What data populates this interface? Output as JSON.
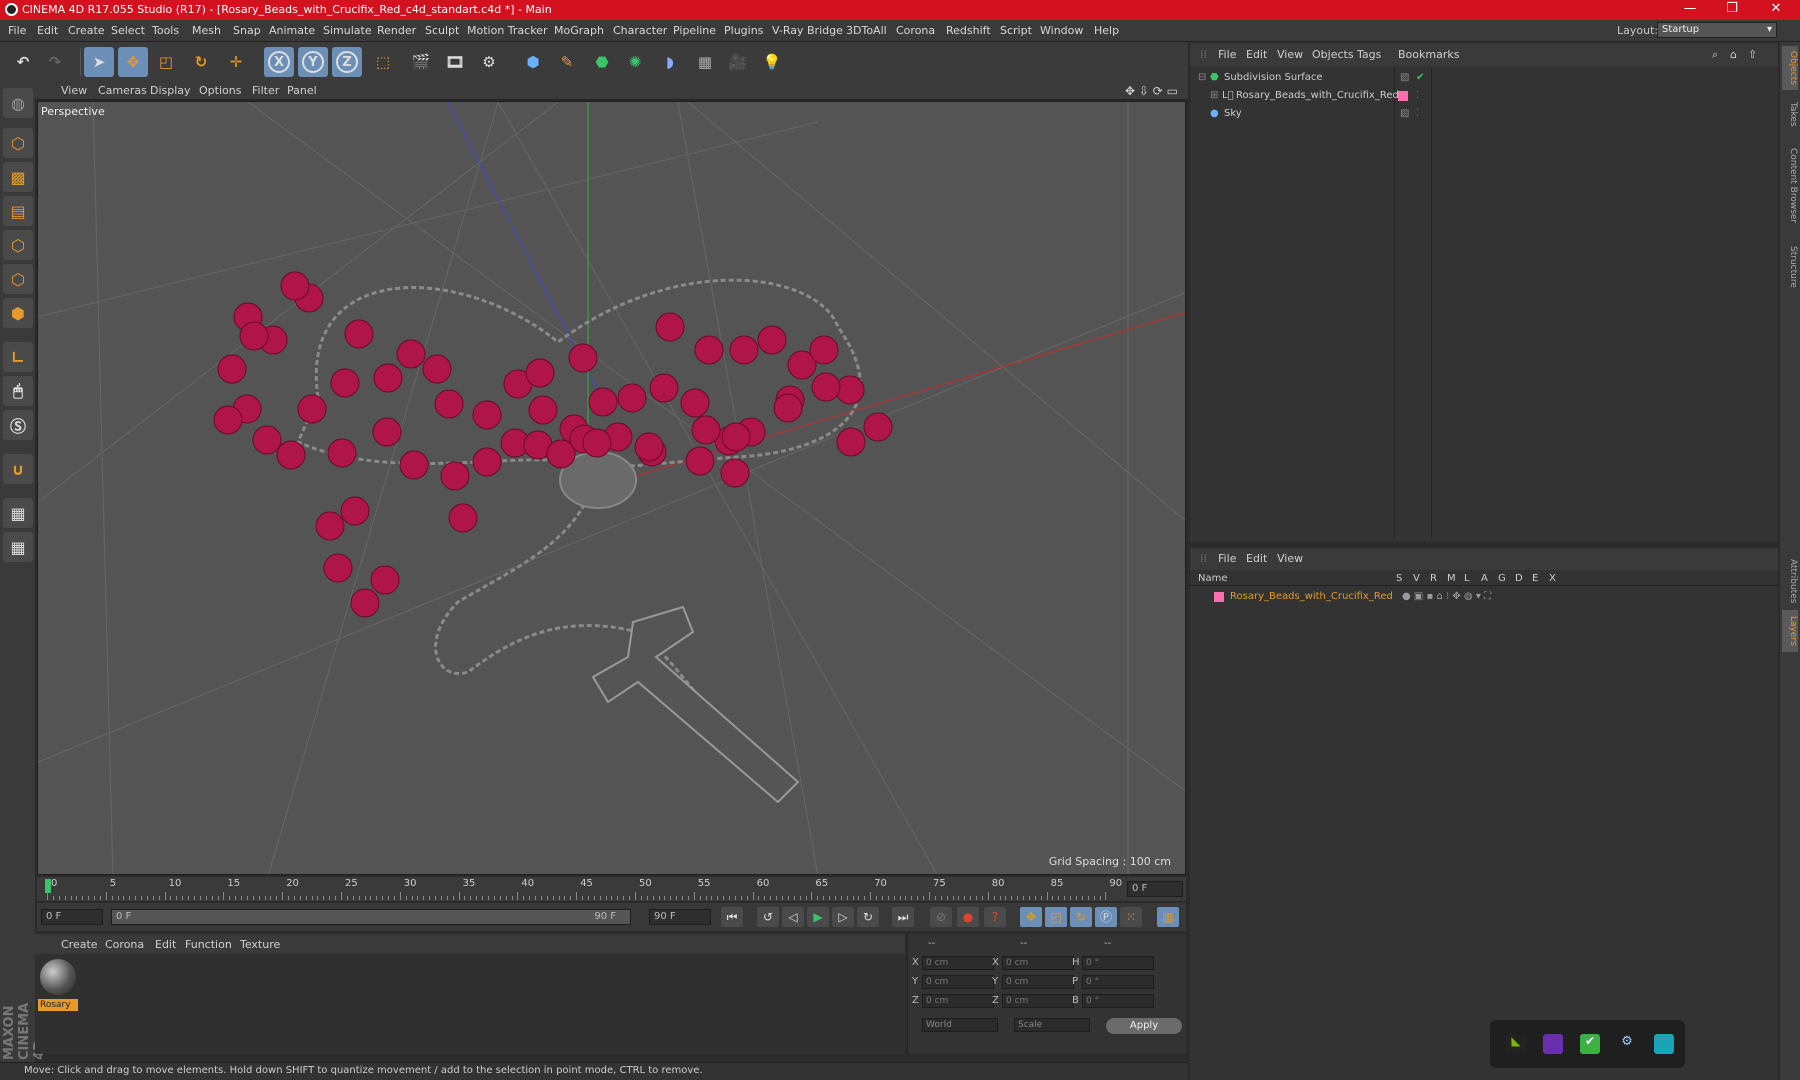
{
  "window": {
    "title": "CINEMA 4D R17.055 Studio (R17) - [Rosary_Beads_with_Crucifix_Red_c4d_standart.c4d *] - Main"
  },
  "menu": [
    "File",
    "Edit",
    "Create",
    "Select",
    "Tools",
    "Mesh",
    "Snap",
    "Animate",
    "Simulate",
    "Render",
    "Sculpt",
    "Motion Tracker",
    "MoGraph",
    "Character",
    "Pipeline",
    "Plugins",
    "V-Ray Bridge",
    "3DToAll",
    "Corona",
    "Redshift",
    "Script",
    "Window",
    "Help"
  ],
  "layout": {
    "label": "Layout:",
    "value": "Startup"
  },
  "viewport": {
    "menu": [
      "View",
      "Cameras",
      "Display",
      "Options",
      "Filter",
      "Panel"
    ],
    "camera": "Perspective",
    "grid_spacing": "Grid Spacing : 100 cm"
  },
  "timeline": {
    "ticks": [
      "0",
      "5",
      "10",
      "15",
      "20",
      "25",
      "30",
      "35",
      "40",
      "45",
      "50",
      "55",
      "60",
      "65",
      "70",
      "75",
      "80",
      "85",
      "90"
    ],
    "end_frame": "0 F"
  },
  "transport": {
    "start": "0 F",
    "range_start": "0 F",
    "range_end": "90 F",
    "end": "90 F"
  },
  "material_manager": {
    "menu": [
      "Create",
      "Corona",
      "Edit",
      "Function",
      "Texture"
    ],
    "materials": [
      "Rosary"
    ]
  },
  "coordinates": {
    "headers": [
      "--",
      "--",
      "--"
    ],
    "rows": [
      {
        "a": "X",
        "av": "0 cm",
        "b": "X",
        "bv": "0 cm",
        "c": "H",
        "cv": "0 °"
      },
      {
        "a": "Y",
        "av": "0 cm",
        "b": "Y",
        "bv": "0 cm",
        "c": "P",
        "cv": "0 °"
      },
      {
        "a": "Z",
        "av": "0 cm",
        "b": "Z",
        "bv": "0 cm",
        "c": "B",
        "cv": "0 °"
      }
    ],
    "mode1": "World",
    "mode2": "Scale",
    "apply": "Apply"
  },
  "object_manager": {
    "menu": [
      "File",
      "Edit",
      "View",
      "Objects",
      "Tags",
      "Bookmarks"
    ],
    "objects": [
      "Subdivision Surface",
      "Rosary_Beads_with_Crucifix_Red",
      "Sky"
    ]
  },
  "layer_manager": {
    "menu": [
      "File",
      "Edit",
      "View"
    ],
    "columns": [
      "Name",
      "S",
      "V",
      "R",
      "M",
      "L",
      "A",
      "G",
      "D",
      "E",
      "X"
    ],
    "layers": [
      "Rosary_Beads_with_Crucifix_Red"
    ]
  },
  "right_tabs": [
    "Objects",
    "Takes",
    "Content Browser",
    "Structure",
    "Attributes",
    "Layers"
  ],
  "status": "Move: Click and drag to move elements. Hold down SHIFT to quantize movement / add to the selection in point mode, CTRL to remove.",
  "brand": "MAXON CINEMA 4D",
  "colors": {
    "titlebar": "#d4111e",
    "accent": "#e59a29",
    "bead": "#b0154a",
    "layer_swatch": "#ff6fb0"
  }
}
